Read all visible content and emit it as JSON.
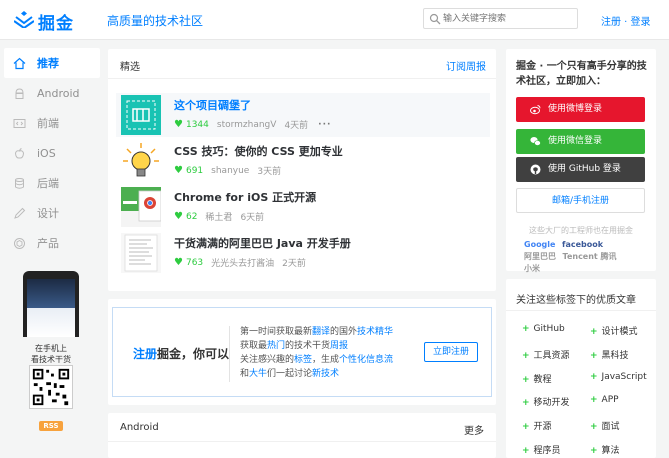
{
  "header": {
    "logo_text": "掘金",
    "slogan": "高质量的技术社区",
    "search_placeholder": "输入关键字搜索",
    "login_label": "注册 · 登录"
  },
  "sidebar": {
    "items": [
      {
        "label": "推荐",
        "icon": "home-icon",
        "active": true
      },
      {
        "label": "Android",
        "icon": "android-icon"
      },
      {
        "label": "前端",
        "icon": "code-icon"
      },
      {
        "label": "iOS",
        "icon": "apple-icon"
      },
      {
        "label": "后端",
        "icon": "database-icon"
      },
      {
        "label": "设计",
        "icon": "pencil-icon"
      },
      {
        "label": "产品",
        "icon": "product-icon"
      }
    ],
    "promo_text_1": "在手机上",
    "promo_text_2": "看技术干货",
    "rss_label": "RSS"
  },
  "feed": {
    "title": "精选",
    "subscribe_label": "订阅周报",
    "entries": [
      {
        "title": "这个项目碉堡了",
        "likes": "1344",
        "author": "stormzhangV",
        "time": "4天前",
        "more": "···"
      },
      {
        "title": "CSS 技巧：使你的 CSS 更加专业",
        "likes": "691",
        "author": "shanyue",
        "time": "3天前"
      },
      {
        "title": "Chrome for iOS 正式开源",
        "likes": "62",
        "author": "稀土君",
        "time": "6天前"
      },
      {
        "title": "干货满满的阿里巴巴 Java 开发手册",
        "likes": "763",
        "author": "光光头去打酱油",
        "time": "2天前"
      }
    ]
  },
  "banner": {
    "cta_prefix": "注册",
    "cta_suffix": "掘金，你可以",
    "lines": [
      {
        "a": "第一时间获取最新",
        "b": "翻译",
        "c": "的国外",
        "d": "技术精华"
      },
      {
        "a": "获取最",
        "b": "热门",
        "c": "的技术干货",
        "d": "周报"
      },
      {
        "a": "关注感兴趣的",
        "b": "标签",
        "c": "，生成",
        "d": "个性化信息流"
      },
      {
        "a": "和",
        "b": "大牛",
        "c": "们一起讨论",
        "d": "新技术"
      }
    ],
    "button_label": "立即注册"
  },
  "android_section": {
    "title": "Android",
    "more_label": "更多"
  },
  "join": {
    "title": "掘金 · 一个只有高手分享的技术社区，立即加入：",
    "weibo_label": "使用微博登录",
    "wechat_label": "使用微信登录",
    "github_label": "使用 GitHub 登录",
    "mail_label": "邮箱/手机注册",
    "trust_text": "这些大厂的工程师也在用掘金",
    "brands": [
      "Google",
      "facebook",
      "阿里巴巴",
      "Tencent 腾讯",
      "小米"
    ],
    "colors": {
      "weibo": "#e6162d",
      "wechat": "#35b539",
      "github": "#404040"
    }
  },
  "tags": {
    "title": "关注这些标签下的优质文章",
    "items": [
      "GitHub",
      "设计模式",
      "工具资源",
      "黑科技",
      "教程",
      "JavaScript",
      "移动开发",
      "APP",
      "开源",
      "面试",
      "程序员",
      "算法"
    ]
  },
  "colors": {
    "accent": "#007fff",
    "like": "#2ecc40"
  }
}
